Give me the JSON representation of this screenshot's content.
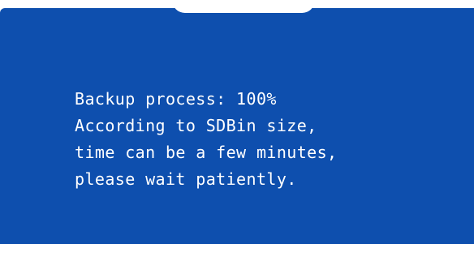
{
  "dialog": {
    "background_color": "#0e4fae",
    "text_color": "#ffffff",
    "lines": [
      "Backup process: 100%",
      "According to SDBin size,",
      "time can be a few minutes,",
      "please wait patiently."
    ]
  },
  "progress": {
    "percent": 100
  }
}
